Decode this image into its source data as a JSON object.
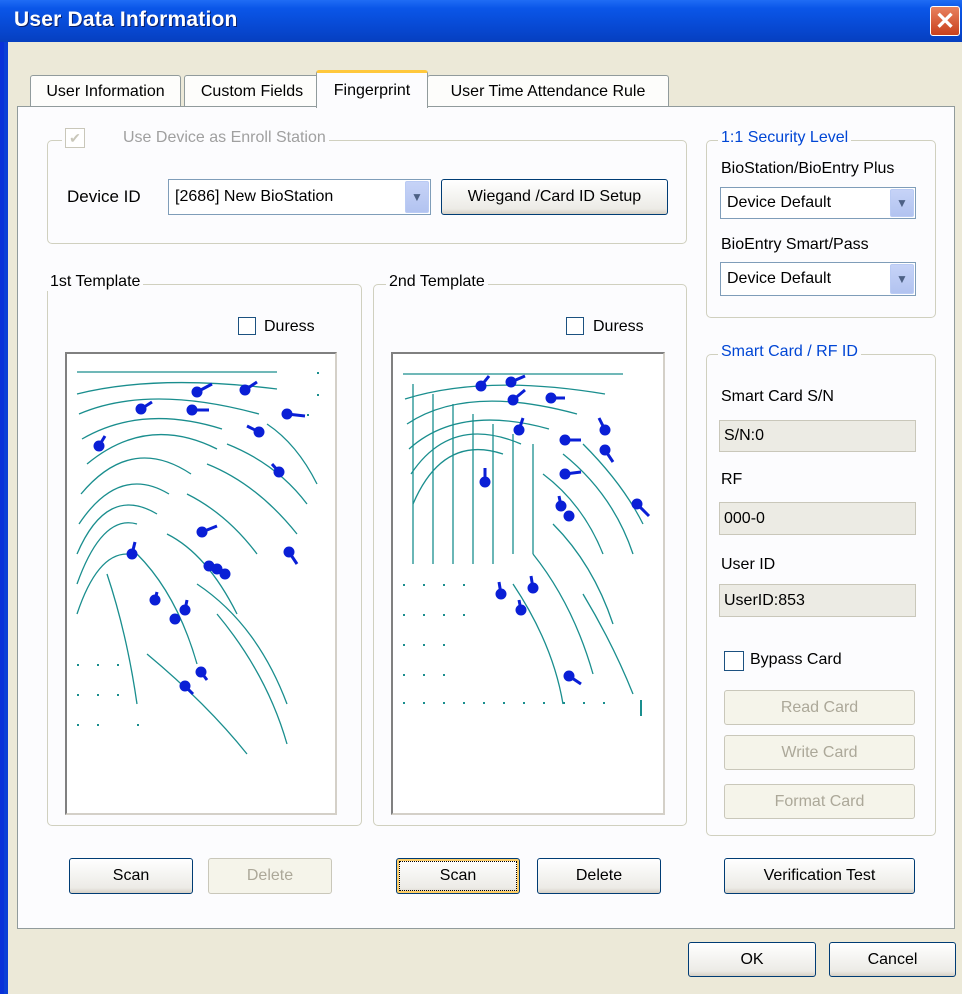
{
  "window": {
    "title": "User Data Information"
  },
  "tabs": [
    {
      "label": "User Information"
    },
    {
      "label": "Custom Fields"
    },
    {
      "label": "Fingerprint"
    },
    {
      "label": "User Time Attendance Rule"
    }
  ],
  "enroll": {
    "checkbox_label": "Use Device as Enroll Station",
    "device_label": "Device ID",
    "device_value": "[2686] New BioStation",
    "wiegand_button": "Wiegand /Card ID Setup"
  },
  "template1": {
    "legend": "1st Template",
    "duress_label": "Duress",
    "scan_label": "Scan",
    "delete_label": "Delete"
  },
  "template2": {
    "legend": "2nd Template",
    "duress_label": "Duress",
    "scan_label": "Scan",
    "delete_label": "Delete"
  },
  "security": {
    "legend": "1:1 Security Level",
    "biostation_label": "BioStation/BioEntry Plus",
    "biostation_value": "Device Default",
    "bioentry_label": "BioEntry Smart/Pass",
    "bioentry_value": "Device Default"
  },
  "smartcard": {
    "legend": "Smart Card / RF ID",
    "sn_label": "Smart Card S/N",
    "sn_value": "S/N:0",
    "rf_label": "RF",
    "rf_value": "000-0",
    "userid_label": "User ID",
    "userid_value": "UserID:853",
    "bypass_label": "Bypass Card",
    "read_card": "Read Card",
    "write_card": "Write Card",
    "format_card": "Format Card"
  },
  "verification_button": "Verification Test",
  "footer": {
    "ok": "OK",
    "cancel": "Cancel"
  }
}
